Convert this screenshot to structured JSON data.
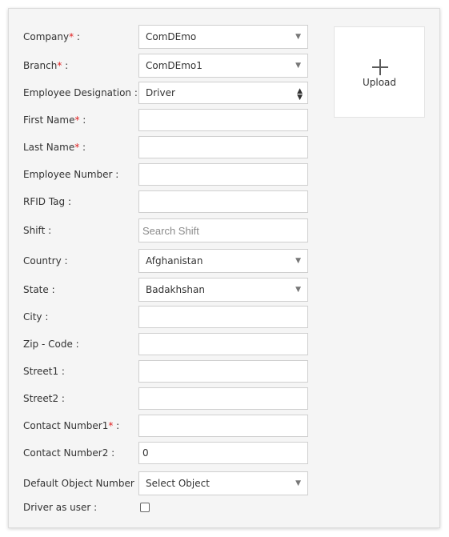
{
  "form": {
    "company": {
      "label": "Company",
      "req": "*",
      "suffix": " :",
      "value": "ComDEmo"
    },
    "branch": {
      "label": "Branch",
      "req": "*",
      "suffix": " :",
      "value": "ComDEmo1"
    },
    "designation": {
      "label": "Employee Designation :",
      "value": "Driver"
    },
    "first_name": {
      "label": "First Name",
      "req": "*",
      "suffix": " :",
      "value": ""
    },
    "last_name": {
      "label": "Last Name",
      "req": "*",
      "suffix": " :",
      "value": ""
    },
    "employee_number": {
      "label": "Employee Number :",
      "value": ""
    },
    "rfid_tag": {
      "label": "RFID Tag :",
      "value": ""
    },
    "shift": {
      "label": "Shift :",
      "placeholder": "Search Shift"
    },
    "country": {
      "label": "Country :",
      "value": "Afghanistan"
    },
    "state": {
      "label": "State :",
      "value": "Badakhshan"
    },
    "city": {
      "label": "City :",
      "value": ""
    },
    "zip": {
      "label": "Zip - Code :",
      "value": ""
    },
    "street1": {
      "label": "Street1 :",
      "value": ""
    },
    "street2": {
      "label": "Street2 :",
      "value": ""
    },
    "contact1": {
      "label": "Contact Number1",
      "req": "*",
      "suffix": " :",
      "value": ""
    },
    "contact2": {
      "label": "Contact Number2 :",
      "value": "0"
    },
    "default_object": {
      "label": "Default Object Number :",
      "value": "Select Object"
    },
    "driver_as_user": {
      "label": "Driver as user :",
      "checked": false
    }
  },
  "upload": {
    "icon": "plus-icon",
    "label": "Upload"
  },
  "icons": {
    "dropdown": "caret-down-icon",
    "spinner": "up-down-arrows-icon"
  }
}
